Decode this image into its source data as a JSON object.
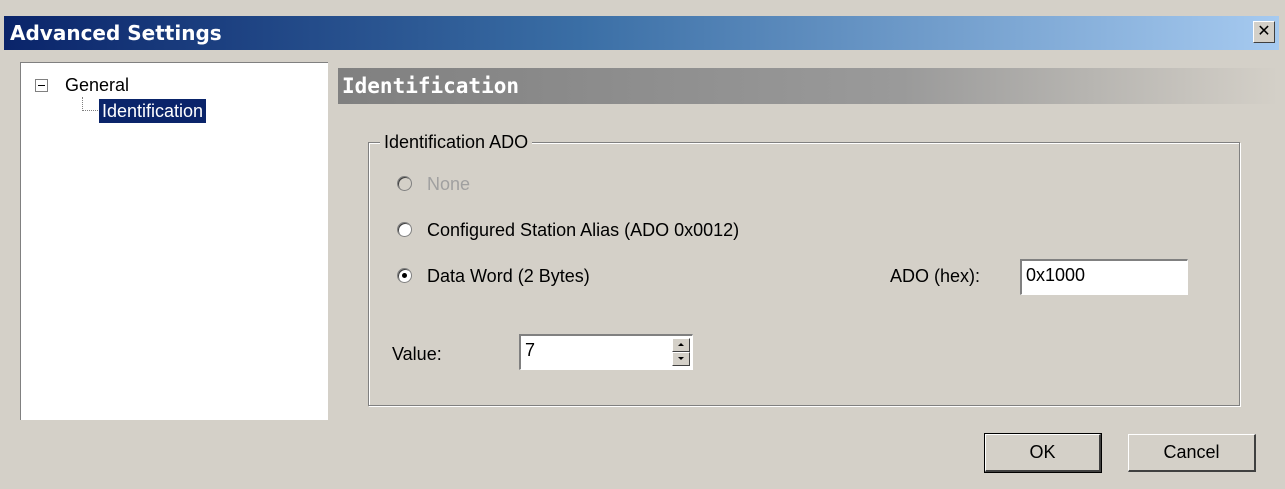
{
  "window": {
    "title": "Advanced Settings",
    "close_glyph": "✕"
  },
  "tree": {
    "items": [
      {
        "label": "General",
        "expanded": true
      },
      {
        "label": "Identification",
        "selected": true
      }
    ]
  },
  "section": {
    "title": "Identification"
  },
  "group": {
    "legend": "Identification ADO",
    "options": [
      {
        "label": "None",
        "enabled": false,
        "selected": false
      },
      {
        "label": "Configured Station Alias (ADO 0x0012)",
        "enabled": true,
        "selected": false
      },
      {
        "label": "Data Word (2 Bytes)",
        "enabled": true,
        "selected": true
      }
    ],
    "ado_label": "ADO (hex):",
    "ado_value": "0x1000",
    "value_label": "Value:",
    "value": "7"
  },
  "buttons": {
    "ok": "OK",
    "cancel": "Cancel"
  },
  "colors": {
    "title_start": "#0a246a",
    "title_end": "#a6caf0",
    "selection": "#0a246a",
    "dialog_bg": "#d4d0c8"
  }
}
